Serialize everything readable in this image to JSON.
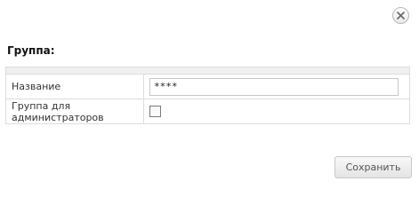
{
  "dialog": {
    "title": "Группа:",
    "close_icon": "close-icon"
  },
  "form": {
    "rows": [
      {
        "label": "Название",
        "type": "text",
        "value": "****"
      },
      {
        "label": "Группа для администраторов",
        "type": "checkbox",
        "checked": false
      }
    ]
  },
  "footer": {
    "save_label": "Сохранить"
  }
}
